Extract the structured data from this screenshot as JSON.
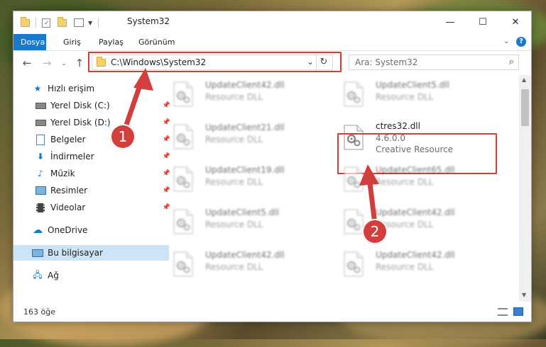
{
  "window": {
    "title": "System32",
    "controls": {
      "minimize": "—",
      "maximize": "☐",
      "close": "✕"
    }
  },
  "ribbon": {
    "tabs": [
      "Dosya",
      "Giriş",
      "Paylaş",
      "Görünüm"
    ],
    "active_tab_color": "#1979ca"
  },
  "nav": {
    "address": "C:\\Windows\\System32",
    "search_placeholder": "Ara: System32"
  },
  "sidebar": {
    "items": [
      {
        "label": "Hızlı erişim",
        "icon": "star-icon"
      },
      {
        "label": "Yerel Disk (C:)",
        "icon": "drive-icon",
        "pinned": true
      },
      {
        "label": "Yerel Disk (D:)",
        "icon": "drive-icon",
        "pinned": true
      },
      {
        "label": "Belgeler",
        "icon": "documents-icon",
        "pinned": true
      },
      {
        "label": "İndirmeler",
        "icon": "download-icon",
        "pinned": true
      },
      {
        "label": "Müzik",
        "icon": "music-icon",
        "pinned": true
      },
      {
        "label": "Resimler",
        "icon": "pictures-icon",
        "pinned": true
      },
      {
        "label": "Videolar",
        "icon": "videos-icon",
        "pinned": true
      },
      {
        "label": "OneDrive",
        "icon": "cloud-icon"
      },
      {
        "label": "Bu bilgisayar",
        "icon": "computer-icon",
        "selected": true
      },
      {
        "label": "Ağ",
        "icon": "network-icon"
      }
    ]
  },
  "files": [
    {
      "name": "UpdateClient42.dll",
      "type": "Resource DLL"
    },
    {
      "name": "UpdateClient5.dll",
      "type": "Resource DLL"
    },
    {
      "name": "UpdateClient21.dll",
      "type": "Resource DLL"
    },
    {
      "name": "ctres32.dll",
      "version": "4.6.0.0",
      "type": "Creative Resource",
      "highlighted": true
    },
    {
      "name": "UpdateClient19.dll",
      "type": "Resource DLL"
    },
    {
      "name": "UpdateClient65.dll",
      "type": "Resource DLL"
    },
    {
      "name": "UpdateClient5.dll",
      "type": "Resource DLL"
    },
    {
      "name": "UpdateClient42.dll",
      "type": "Resource DLL"
    },
    {
      "name": "UpdateClient42.dll",
      "type": "Resource DLL"
    },
    {
      "name": "UpdateClient42.dll",
      "type": "Resource DLL"
    }
  ],
  "status": {
    "item_count": "163 öğe"
  },
  "annotations": {
    "step1": "1",
    "step2": "2",
    "color": "#d83a3a"
  }
}
